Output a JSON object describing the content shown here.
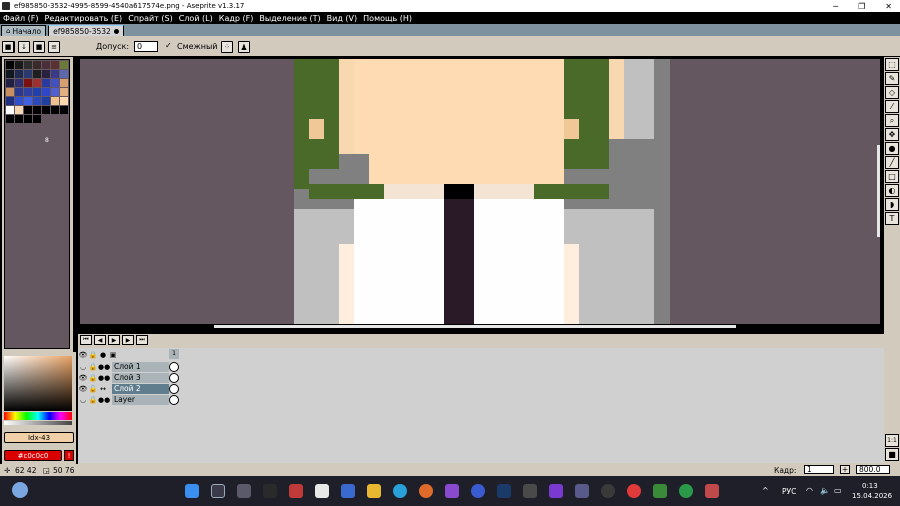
{
  "window": {
    "title": "ef985850-3532-4995-8599-4540a617574e.png - Aseprite v1.3.17",
    "minimize": "─",
    "maximize": "❐",
    "close": "✕"
  },
  "menu": [
    {
      "label": "Файл (F)"
    },
    {
      "label": "Редактировать (E)"
    },
    {
      "label": "Спрайт (S)"
    },
    {
      "label": "Слой (L)"
    },
    {
      "label": "Кадр (F)"
    },
    {
      "label": "Выделение (T)"
    },
    {
      "label": "Вид (V)"
    },
    {
      "label": "Помощь (H)"
    }
  ],
  "tabs": [
    {
      "label": "Начало",
      "icon": "home-icon"
    },
    {
      "label": "ef985850-3532",
      "icon": "modified-dot-icon"
    }
  ],
  "context_bar": {
    "tolerance_label": "Допуск:",
    "tolerance_value": "0",
    "contiguous_label": "Смежный",
    "contiguous_checked": true
  },
  "palette": {
    "colors": [
      "#000000",
      "#1a1a1a",
      "#2d2d2d",
      "#3b2a2a",
      "#4a2f3b",
      "#5a3030",
      "#6b7a3a",
      "#101820",
      "#1e2a50",
      "#2a3a70",
      "#1e1e1e",
      "#2a2040",
      "#3a3a8a",
      "#5a6aaa",
      "#202040",
      "#303070",
      "#7a1010",
      "#a03030",
      "#2a3aa0",
      "#4050c0",
      "#d8a070",
      "#c89060",
      "#2a3a90",
      "#3040a0",
      "#2040b0",
      "#3048c8",
      "#5060d0",
      "#e0b080",
      "#203080",
      "#3050d0",
      "#4060e0",
      "#2a48c0",
      "#2040a0",
      "#f0c090",
      "#ffd8b0",
      "#ffffff",
      "#f4d6b4",
      "#000000",
      "#000000",
      "#000000",
      "#000000",
      "#000000",
      "#000000",
      "#000000",
      "#000000",
      "#000000"
    ],
    "selected_index_label": "8"
  },
  "color": {
    "index_label": "Idx-43",
    "hex_label": "#c0c0c0",
    "accent": "#d80000"
  },
  "timeline": {
    "buttons": [
      "first-frame",
      "prev-frame",
      "play",
      "next-frame",
      "last-frame"
    ],
    "frame_number": "1",
    "layers": [
      {
        "name": "Слой 1",
        "visible": false,
        "selected": false
      },
      {
        "name": "Слой 3",
        "visible": true,
        "selected": false
      },
      {
        "name": "Слой 2",
        "visible": true,
        "selected": true
      },
      {
        "name": "Layer",
        "visible": false,
        "selected": false
      }
    ]
  },
  "status": {
    "cursor": "62 42",
    "size": "50 76",
    "frame_label": "Кадр:",
    "frame_value": "1",
    "zoom_value": "800.0"
  },
  "taskbar": {
    "lang": "РУС",
    "time": "0:13",
    "date": "15.04.2026"
  }
}
